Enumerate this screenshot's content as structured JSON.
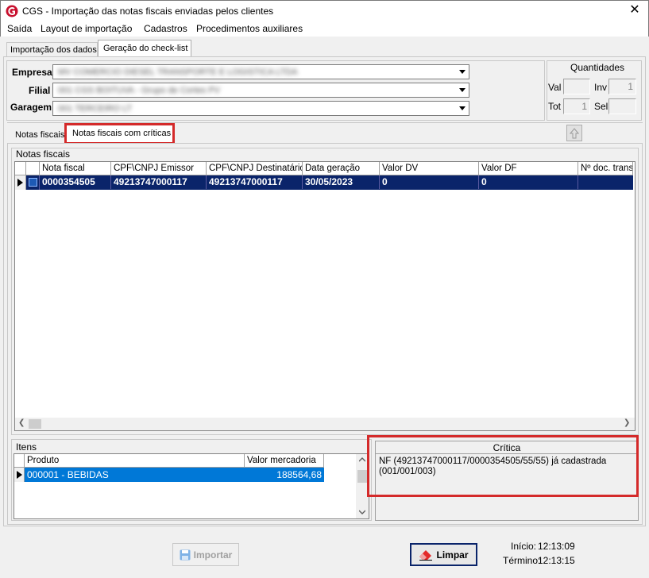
{
  "window": {
    "title": "CGS - Importação das notas fiscais enviadas pelos clientes",
    "close_glyph": "✕"
  },
  "menu": [
    "Saída",
    "Layout de importação",
    "Cadastros",
    "Procedimentos auxiliares"
  ],
  "main_tabs": [
    "Importação dos dados",
    "Geração do check-list"
  ],
  "form": {
    "empresa_label": "Empresa",
    "filial_label": "Filial",
    "garagem_label": "Garagem",
    "empresa_value": "MV COMERCIO DIESEL TRANSPORTE E LOGISTICA LTDA",
    "filial_value": "001 CGS BOITUVA - Grupo de Cortes PV",
    "garagem_value": "001 TERCEIRO LT"
  },
  "quantidades": {
    "title": "Quantidades",
    "val_label": "Val",
    "val_value": "",
    "inv_label": "Inv",
    "inv_value": "1",
    "tot_label": "Tot",
    "tot_value": "1",
    "sel_label": "Sel",
    "sel_value": ""
  },
  "sub_tabs": [
    "Notas fiscais",
    "Notas fiscais com críticas"
  ],
  "notas_group_title": "Notas fiscais",
  "notas_table": {
    "columns": [
      "Nota fiscal",
      "CPF\\CNPJ Emissor",
      "CPF\\CNPJ Destinatário",
      "Data geração",
      "Valor DV",
      "Valor DF",
      "Nº doc. trans"
    ],
    "rows": [
      [
        "0000354505",
        "49213747000117",
        "49213747000117",
        "30/05/2023",
        "0",
        "0",
        ""
      ]
    ]
  },
  "itens": {
    "title": "Itens",
    "columns": [
      "Produto",
      "Valor mercadoria"
    ],
    "rows": [
      [
        "000001 - BEBIDAS",
        "188564,68"
      ]
    ]
  },
  "critica": {
    "title": "Crítica",
    "text": "NF (49213747000117/0000354505/55/55) já cadastrada (001/001/003)"
  },
  "buttons": {
    "importar": "Importar",
    "limpar": "Limpar"
  },
  "status": {
    "inicio_label": "Início:",
    "inicio_value": "12:13:09",
    "termino_label": "Término:",
    "termino_value": "12:13:15"
  },
  "colors": {
    "selection": "#0a246a",
    "item_selection": "#0078d7",
    "highlight": "#d42a2a",
    "logo": "#c8102e"
  }
}
